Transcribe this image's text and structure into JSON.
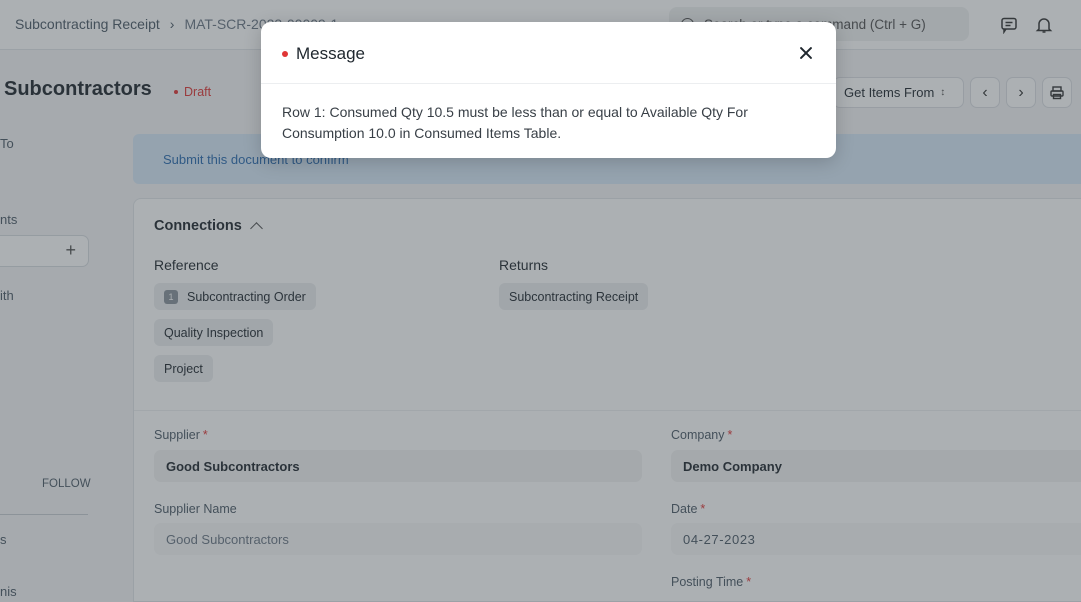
{
  "navbar": {
    "breadcrumbs": [
      "Subcontracting Receipt",
      "MAT-SCR-2023-00009-1"
    ],
    "search_placeholder": "Search or type a command (Ctrl + G)"
  },
  "title_bar": {
    "title": "Subcontractors",
    "status": "Draft",
    "get_items_label": "Get Items From"
  },
  "sidebar": {
    "assigned_to": "To",
    "attachments": "nts",
    "shared_with": "ith",
    "follow": "FOLLOW",
    "item_a": "s",
    "item_b": "nis"
  },
  "banner": {
    "text": "Submit this document to confirm"
  },
  "connections": {
    "title": "Connections",
    "reference": {
      "label": "Reference",
      "items": [
        {
          "label": "Subcontracting Order",
          "count": "1"
        },
        {
          "label": "Quality Inspection"
        },
        {
          "label": "Project"
        }
      ]
    },
    "returns": {
      "label": "Returns",
      "items": [
        {
          "label": "Subcontracting Receipt"
        }
      ]
    }
  },
  "form": {
    "supplier": {
      "label": "Supplier",
      "value": "Good Subcontractors"
    },
    "supplier_name": {
      "label": "Supplier Name",
      "value": "Good Subcontractors"
    },
    "company": {
      "label": "Company",
      "value": "Demo Company"
    },
    "date": {
      "label": "Date",
      "value": "04-27-2023"
    },
    "posting_time": {
      "label": "Posting Time"
    }
  },
  "modal": {
    "title": "Message",
    "body": "Row 1: Consumed Qty 10.5 must be less than or equal to Available Qty For Consumption 10.0 in Consumed Items Table.",
    "indicator_color": "#e03636"
  },
  "colors": {
    "danger": "#e03636",
    "banner_bg": "#d7e9f9",
    "banner_text": "#2b6cb0"
  }
}
